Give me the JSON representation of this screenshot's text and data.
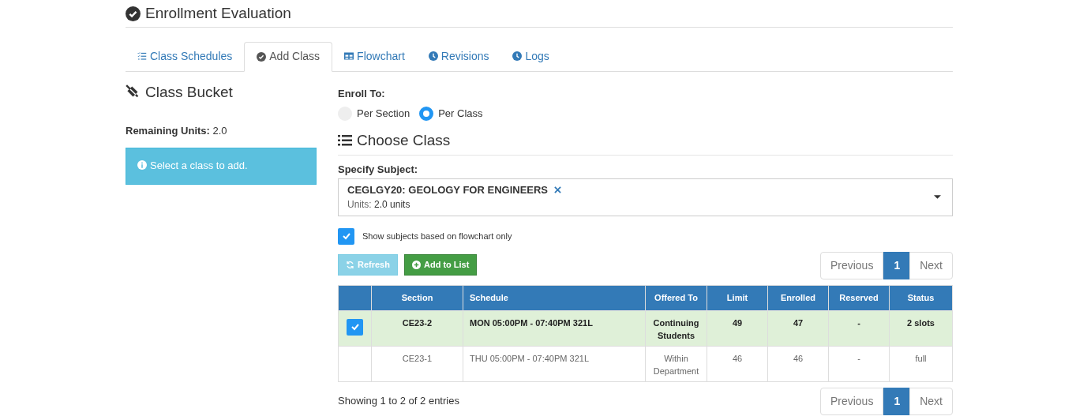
{
  "page_title": "Enrollment Evaluation",
  "tabs": [
    {
      "label": "Class Schedules",
      "selected": false
    },
    {
      "label": "Add Class",
      "selected": true
    },
    {
      "label": "Flowchart",
      "selected": false
    },
    {
      "label": "Revisions",
      "selected": false
    },
    {
      "label": "Logs",
      "selected": false
    }
  ],
  "bucket": {
    "title": "Class Bucket",
    "remaining_label": "Remaining Units:",
    "remaining_value": "2.0",
    "alert": "Select a class to add."
  },
  "enroll_to": {
    "label": "Enroll To:",
    "options": [
      {
        "label": "Per Section",
        "selected": false
      },
      {
        "label": "Per Class",
        "selected": true
      }
    ]
  },
  "choose_class": {
    "title": "Choose Class",
    "subject_label": "Specify Subject:",
    "subject": "CEGLGY20: GEOLOGY FOR ENGINEERS",
    "units_label": "Units:",
    "units_value": "2.0 units",
    "flowchart_only": {
      "label": "Show subjects based on flowchart only",
      "checked": true
    }
  },
  "buttons": [
    {
      "label": "Refresh",
      "kind": "refresh",
      "disabled": true
    },
    {
      "label": "Add to List",
      "kind": "add",
      "disabled": false
    }
  ],
  "pagination_top": {
    "previous": "Previous",
    "pages": [
      {
        "label": "1",
        "selected": true
      }
    ],
    "next": "Next"
  },
  "table": {
    "columns": [
      "",
      "Section",
      "Schedule",
      "Offered To",
      "Limit",
      "Enrolled",
      "Reserved",
      "Status"
    ],
    "rows": [
      {
        "selected": true,
        "cells": [
          "",
          "CE23-2",
          "MON 05:00PM - 07:40PM 321L",
          "Continuing Students",
          "49",
          "47",
          "-",
          "2 slots"
        ]
      },
      {
        "selected": false,
        "cells": [
          "",
          "CE23-1",
          "THU 05:00PM - 07:40PM 321L",
          "Within Department",
          "46",
          "46",
          "-",
          "full"
        ]
      }
    ]
  },
  "footer": "Showing 1 to 2 of 2 entries",
  "pagination_bottom": {
    "previous": "Previous",
    "pages": [
      {
        "label": "1",
        "selected": true
      }
    ],
    "next": "Next"
  }
}
